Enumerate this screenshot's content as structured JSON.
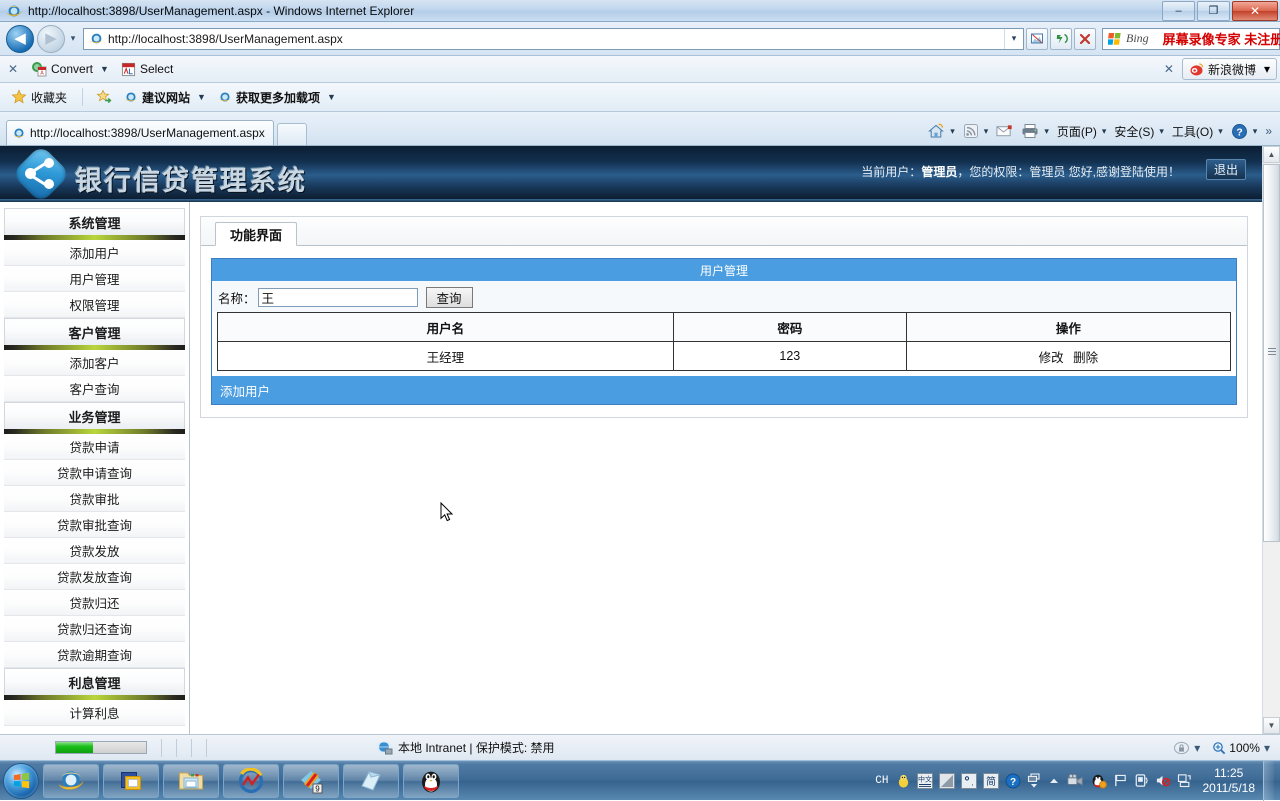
{
  "window": {
    "title": "http://localhost:3898/UserManagement.aspx - Windows Internet Explorer",
    "minimize_label": "–",
    "restore_label": "❐",
    "close_label": "✕"
  },
  "nav": {
    "back_label": "◀",
    "forward_label": "▶",
    "history_dropdown_label": "▾",
    "address_value": "http://localhost:3898/UserManagement.aspx",
    "address_host": "localhost",
    "address_scheme": "http://",
    "address_path": ":3898/UserManagement.aspx",
    "address_dropdown_label": "▾",
    "compat_view_label": "⌸",
    "refresh_label": "↻",
    "stop_label": "✕",
    "search_provider": "Bing",
    "search_overlay_text": "屏幕录像专家 未注册",
    "search_go_label": "🔍",
    "search_dropdown_label": "▾"
  },
  "convert_toolbar": {
    "close_label": "✕",
    "items": [
      {
        "label": "Convert",
        "caret": "▼",
        "icon": "pdf-convert-icon"
      },
      {
        "label": "Select",
        "caret": "",
        "icon": "pdf-select-icon"
      }
    ],
    "right_close_label": "✕",
    "weibo_label": "新浪微博",
    "weibo_caret": "▾"
  },
  "favorites_bar": {
    "favorites_label": "收藏夹",
    "items": [
      {
        "label": "建议网站",
        "caret": "▼"
      },
      {
        "label": "获取更多加载项",
        "caret": "▼"
      }
    ]
  },
  "tabs": {
    "open_tabs": [
      {
        "label": "http://localhost:3898/UserManagement.aspx"
      }
    ],
    "new_tab_label": ""
  },
  "command_bar": {
    "home_caret": "▾",
    "feeds_caret": "▾",
    "items": [
      {
        "label": "页面(P)",
        "caret": "▾"
      },
      {
        "label": "安全(S)",
        "caret": "▾"
      },
      {
        "label": "工具(O)",
        "caret": "▾"
      }
    ],
    "help_caret": "▾",
    "overflow_label": "»"
  },
  "app": {
    "title": "银行信贷管理系统",
    "user_info_prefix": "当前用户：",
    "user_name": "管理员",
    "user_info_suffix": "，您的权限：管理员 您好,感谢登陆使用！",
    "logout_label": "退出"
  },
  "sidebar": {
    "sections": [
      {
        "title": "系统管理",
        "items": [
          "添加用户",
          "用户管理",
          "权限管理"
        ]
      },
      {
        "title": "客户管理",
        "items": [
          "添加客户",
          "客户查询"
        ]
      },
      {
        "title": "业务管理",
        "items": [
          "贷款申请",
          "贷款申请查询",
          "贷款审批",
          "贷款审批查询",
          "贷款发放",
          "贷款发放查询",
          "贷款归还",
          "贷款归还查询",
          "贷款逾期查询"
        ]
      },
      {
        "title": "利息管理",
        "items": [
          "计算利息"
        ]
      }
    ]
  },
  "main": {
    "tab_label": "功能界面",
    "panel_title": "用户管理",
    "search": {
      "label": "名称：",
      "value": "王",
      "placeholder": "",
      "button_label": "查询"
    },
    "table": {
      "columns": [
        "用户名",
        "密码",
        "操作"
      ],
      "rows": [
        {
          "username": "王经理",
          "password": "123",
          "edit_label": "修改",
          "delete_label": "删除"
        }
      ]
    },
    "footer_link": "添加用户"
  },
  "status_bar": {
    "progress_percent": 41,
    "zone_text": "本地 Intranet | 保护模式: 禁用",
    "privacy_caret": "▾",
    "zoom_level": "100%",
    "zoom_caret": "▾"
  },
  "taskbar": {
    "start_label": "",
    "tasks": [
      {
        "icon": "internet-explorer-icon"
      },
      {
        "icon": "window-app-icon"
      },
      {
        "icon": "file-explorer-icon"
      },
      {
        "icon": "media-chart-icon"
      },
      {
        "icon": "editor-app-icon",
        "badge": "9"
      },
      {
        "icon": "notepad-app-icon"
      },
      {
        "icon": "qq-penguin-icon"
      }
    ],
    "tray": {
      "input_lang": "CH",
      "icons": [
        "chick-icon",
        "ime-chinese-icon",
        "ime-mode-icon",
        "ime-punct-icon",
        "ime-simplified-icon",
        "help-icon",
        "ime-toolbar-icon",
        "show-hidden-icons-icon",
        "screen-recorder-icon",
        "qq-tray-icon",
        "flag-action-center-icon",
        "network-icon",
        "volume-muted-icon",
        "display-icon"
      ],
      "time": "11:25",
      "date": "2011/5/18"
    }
  },
  "colors": {
    "panel_blue": "#4a9de0",
    "panel_border_blue": "#3f7fc1",
    "header_dark": "#12304f",
    "accent_green": "#b9d63c",
    "red_text": "#d40000"
  }
}
